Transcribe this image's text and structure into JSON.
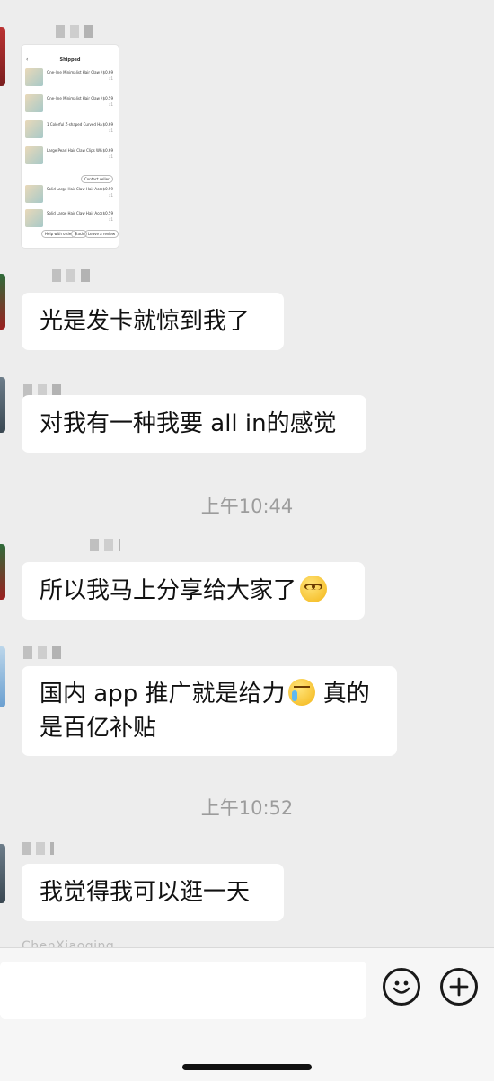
{
  "thumbnail": {
    "title": "Shipped",
    "back_icon": "chevron-left-icon",
    "items": [
      {
        "name": "One-line Minimalist Hair Claw Me...",
        "price": "$0.69",
        "qty": "x1"
      },
      {
        "name": "One-line Minimalist Hair Claw Me...",
        "price": "$0.59",
        "qty": "x1"
      },
      {
        "name": "1 Colorful Z-shaped Curved Hair ...",
        "price": "$0.69",
        "qty": "x1"
      },
      {
        "name": "Large Pearl Hair Claw Clips Whit...",
        "price": "$0.69",
        "qty": "x1"
      },
      {
        "name": "Solid Large Hair Claw Hair Acces...",
        "price": "$0.59",
        "qty": "x1"
      },
      {
        "name": "Solid Large Hair Claw Hair Acces...",
        "price": "$0.59",
        "qty": "x1"
      }
    ],
    "contact_seller": "Contact seller",
    "buttons": [
      "Help with order",
      "Track",
      "Leave a review"
    ]
  },
  "messages": [
    {
      "text": "光是发卡就惊到我了"
    },
    {
      "text": "对我有一种我要 all in的感觉"
    },
    {
      "text": "所以我马上分享给大家了",
      "emoji": "grinning-squint-emoji"
    },
    {
      "text_line1": "国内 app 推广就是给力",
      "emoji": "crying-laugh-emoji",
      "text_line1_tail": " 真的",
      "text_line2": "是百亿补贴"
    },
    {
      "text": "我觉得我可以逛一天"
    }
  ],
  "timestamps": [
    "上午10:44",
    "上午10:52"
  ],
  "truncated_name": "ChenXiaoqing",
  "input_bar": {
    "emoji_icon": "smiley-face-icon",
    "plus_icon": "plus-circle-icon"
  },
  "colors": {
    "background": "#ededed",
    "bubble": "#ffffff",
    "timestamp": "#9c9c9c"
  }
}
